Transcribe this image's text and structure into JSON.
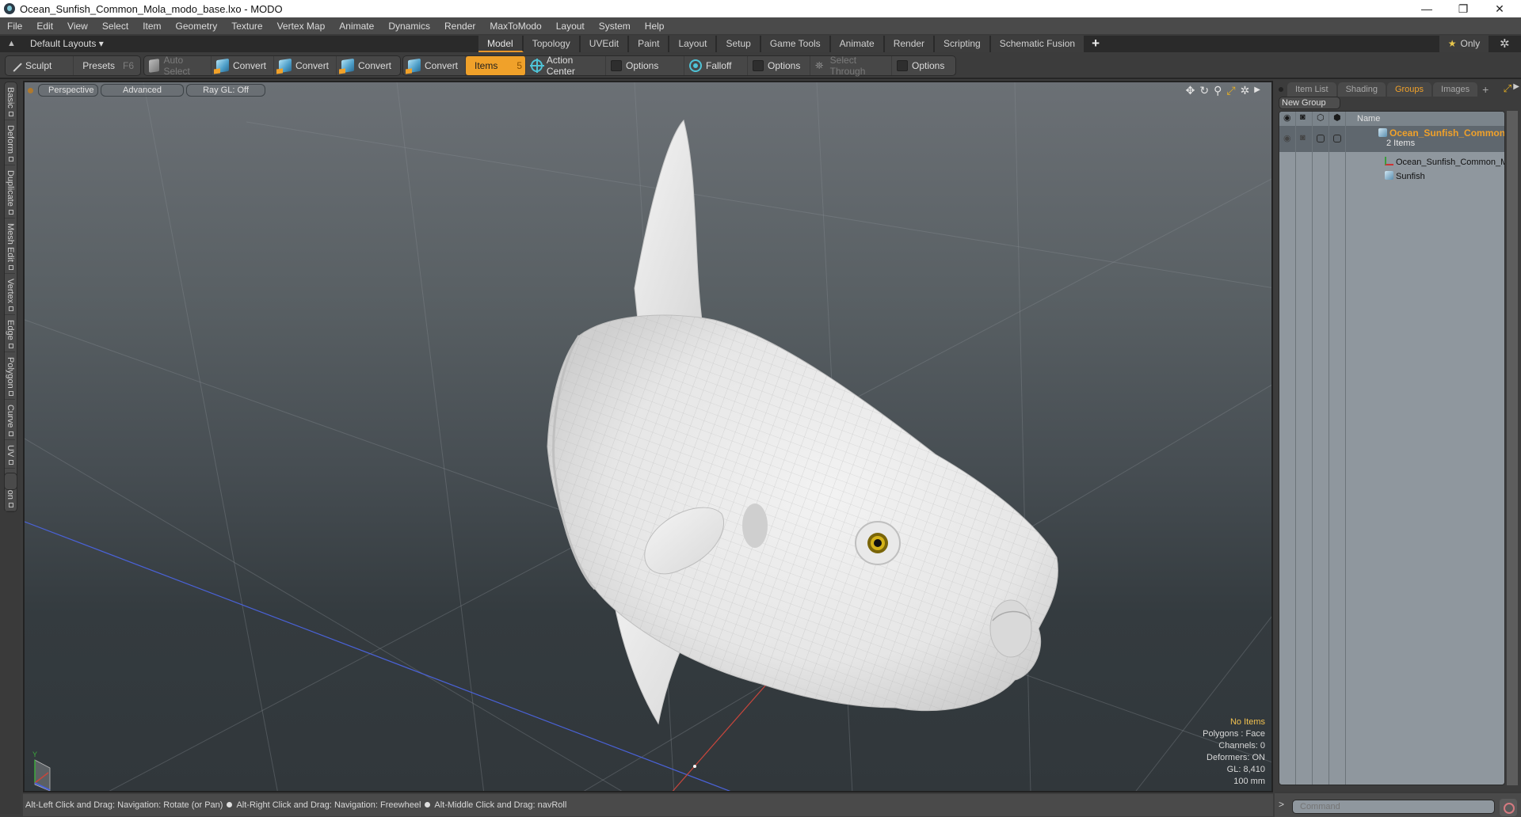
{
  "window": {
    "title": "Ocean_Sunfish_Common_Mola_modo_base.lxo - MODO",
    "controls": [
      "minimize",
      "restore",
      "close"
    ]
  },
  "menu": [
    "File",
    "Edit",
    "View",
    "Select",
    "Item",
    "Geometry",
    "Texture",
    "Vertex Map",
    "Animate",
    "Dynamics",
    "Render",
    "MaxToModo",
    "Layout",
    "System",
    "Help"
  ],
  "layoutbar": {
    "layouts_label": "Default Layouts ▾",
    "tabs": [
      {
        "label": "Model",
        "active": true
      },
      {
        "label": "Topology"
      },
      {
        "label": "UVEdit"
      },
      {
        "label": "Paint"
      },
      {
        "label": "Layout"
      },
      {
        "label": "Setup"
      },
      {
        "label": "Game Tools"
      },
      {
        "label": "Animate"
      },
      {
        "label": "Render"
      },
      {
        "label": "Scripting"
      },
      {
        "label": "Schematic Fusion"
      }
    ],
    "add_tab": "+",
    "only_label": "Only"
  },
  "toolbar": {
    "sculpt": "Sculpt",
    "presets": "Presets",
    "presets_hotkey": "F6",
    "auto_select": "Auto Select",
    "convert1": "Convert",
    "convert2": "Convert",
    "convert3": "Convert",
    "convert4": "Convert",
    "items": "Items",
    "items_hotkey": "5",
    "action_center": "Action Center",
    "options1": "Options",
    "falloff": "Falloff",
    "options2": "Options",
    "select_through": "Select Through",
    "options3": "Options"
  },
  "left_tabs": [
    "Basic",
    "Deform",
    "Duplicate",
    "Mesh Edit",
    "Vertex",
    "Edge",
    "Polygon",
    "Curve",
    "UV",
    "Fusion"
  ],
  "viewport": {
    "view_mode": "Perspective",
    "shading": "Advanced",
    "raygl": "Ray GL: Off",
    "info": {
      "selection": "No Items",
      "polygons": "Polygons : Face",
      "channels": "Channels: 0",
      "deformers": "Deformers: ON",
      "gl": "GL: 8,410",
      "scale": "100 mm"
    },
    "axis_label": "Y",
    "colors": {
      "x_axis": "#c8463c",
      "z_axis": "#4a62d8",
      "y_axis": "#3caa3c",
      "accent": "#f0a12a"
    }
  },
  "statusbar": {
    "hints": [
      "Alt-Left Click and Drag: Navigation: Rotate (or Pan)",
      "Alt-Right Click and Drag: Navigation: Freewheel",
      "Alt-Middle Click and Drag: navRoll"
    ]
  },
  "rightpanel": {
    "tabs": [
      {
        "label": "Item List"
      },
      {
        "label": "Shading"
      },
      {
        "label": "Groups",
        "active": true
      },
      {
        "label": "Images"
      }
    ],
    "add_tab": "+",
    "new_group": "New Group",
    "table_header": "Name",
    "group": {
      "name": "Ocean_Sunfish_Common_...",
      "count": "2 Items",
      "items": [
        {
          "name": "Ocean_Sunfish_Common_Mola",
          "type": "locator"
        },
        {
          "name": "Sunfish",
          "type": "mesh"
        }
      ]
    },
    "command_placeholder": "Command",
    "command_prompt": ">"
  }
}
